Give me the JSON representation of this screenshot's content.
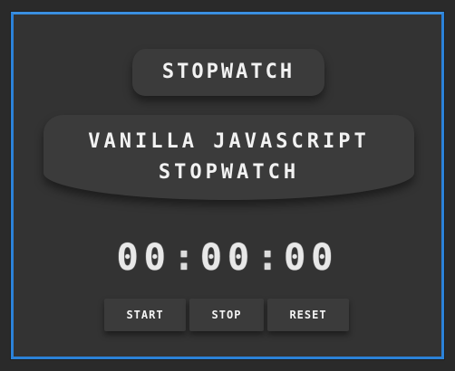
{
  "header": {
    "title": "STOPWATCH"
  },
  "subtitle": {
    "line1": "VANILLA JAVASCRIPT",
    "line2": "STOPWATCH"
  },
  "timer": {
    "minutes": "00",
    "seconds": "00",
    "hundredths": "00",
    "separator": ":"
  },
  "controls": {
    "start_label": "START",
    "stop_label": "STOP",
    "reset_label": "RESET"
  },
  "colors": {
    "frame_border": "#2b82d9",
    "background": "#333333",
    "chip": "#3b3b3b",
    "text": "#f2f2f2"
  }
}
